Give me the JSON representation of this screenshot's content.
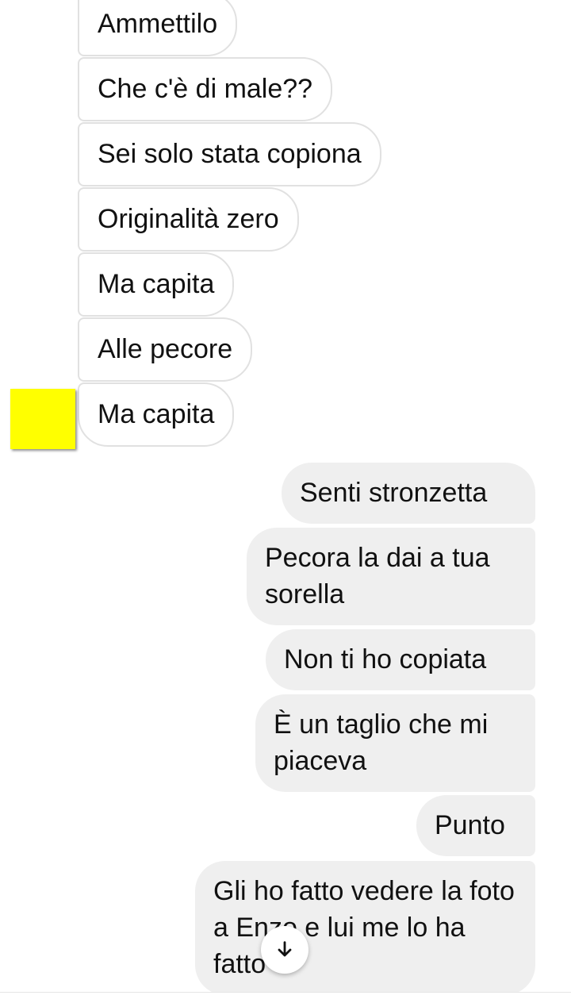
{
  "chat": {
    "incoming": [
      {
        "text": "Ammettilo"
      },
      {
        "text": "Che c'è di male??"
      },
      {
        "text": "Sei solo stata copiona"
      },
      {
        "text": "Originalità zero"
      },
      {
        "text": "Ma capita"
      },
      {
        "text": "Alle pecore"
      },
      {
        "text": "Ma capita"
      }
    ],
    "outgoing": [
      {
        "text": "Senti stronzetta"
      },
      {
        "text": "Pecora la dai a tua sorella"
      },
      {
        "text": "Non ti ho copiata"
      },
      {
        "text": "È un taglio che mi piaceva"
      },
      {
        "text": "Punto"
      },
      {
        "text": "Gli ho fatto vedere la foto a Enzo e lui me lo ha fatto"
      }
    ],
    "avatar_color": "#ffff00",
    "scroll_button_icon": "arrow-down-icon"
  }
}
